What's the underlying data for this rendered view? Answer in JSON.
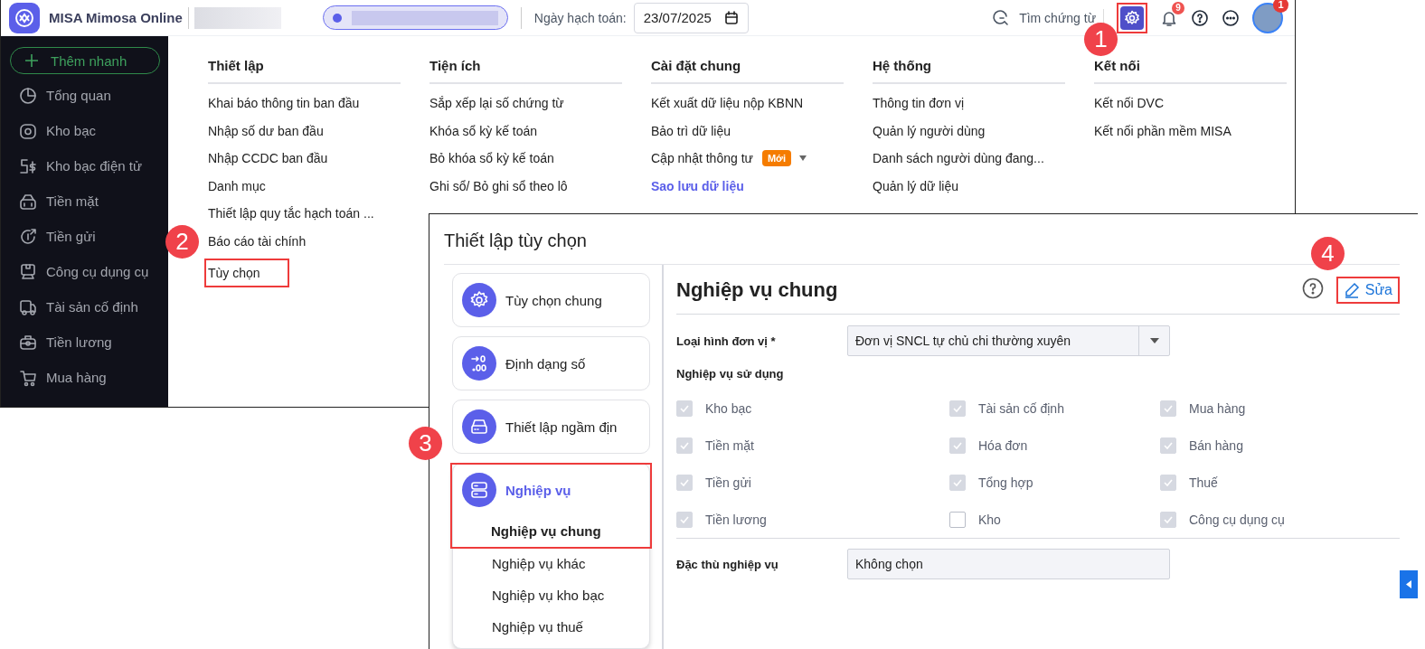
{
  "app": {
    "name": "MISA Mimosa Online",
    "date_label": "Ngày hạch toán:",
    "date_value": "23/07/2025",
    "search_label": "Tìm chứng từ",
    "settings_highlighted": true,
    "notification_count": "9",
    "avatar_badge": "1"
  },
  "sidebar": {
    "quick_add": "Thêm nhanh",
    "items": [
      {
        "label": "Tổng quan"
      },
      {
        "label": "Kho bạc"
      },
      {
        "label": "Kho bạc điện tử"
      },
      {
        "label": "Tiền mặt"
      },
      {
        "label": "Tiền gửi"
      },
      {
        "label": "Công cụ dụng cụ"
      },
      {
        "label": "Tài sản cố định"
      },
      {
        "label": "Tiền lương"
      },
      {
        "label": "Mua hàng"
      }
    ]
  },
  "menu_columns": [
    {
      "heading": "Thiết lập",
      "items": [
        {
          "kind": "plain",
          "label": "Khai báo thông tin ban đầu",
          "highlighted": false
        },
        {
          "kind": "plain",
          "label": "Nhập số dư ban đầu",
          "highlighted": false
        },
        {
          "kind": "plain",
          "label": "Nhập CCDC ban đầu",
          "highlighted": false
        },
        {
          "kind": "plain",
          "label": "Danh mục",
          "highlighted": false
        },
        {
          "kind": "plain",
          "label": "Thiết lập quy tắc hạch toán ...",
          "highlighted": false
        },
        {
          "kind": "plain",
          "label": "Báo cáo tài chính",
          "highlighted": false
        },
        {
          "kind": "plain",
          "label": "Tùy chọn",
          "highlighted": true
        }
      ]
    },
    {
      "heading": "Tiện ích",
      "items": [
        {
          "kind": "plain",
          "label": "Sắp xếp lại số chứng từ",
          "highlighted": false
        },
        {
          "kind": "plain",
          "label": "Khóa sổ kỳ kế toán",
          "highlighted": false
        },
        {
          "kind": "plain",
          "label": "Bỏ khóa sổ kỳ kế toán",
          "highlighted": false
        },
        {
          "kind": "plain",
          "label": "Ghi sổ/ Bỏ ghi sổ theo lô",
          "highlighted": false
        }
      ]
    },
    {
      "heading": "Cài đặt chung",
      "items": [
        {
          "kind": "plain",
          "label": "Kết xuất dữ liệu nộp KBNN",
          "highlighted": false
        },
        {
          "kind": "plain",
          "label": "Bảo trì dữ liệu",
          "highlighted": false
        },
        {
          "kind": "badge",
          "label": "Cập nhật thông tư",
          "badge": "Mới",
          "highlighted": false
        },
        {
          "kind": "accent",
          "label": "Sao lưu dữ liệu",
          "highlighted": false
        }
      ]
    },
    {
      "heading": "Hệ thống",
      "items": [
        {
          "kind": "plain",
          "label": "Thông tin đơn vị",
          "highlighted": false
        },
        {
          "kind": "plain",
          "label": "Quản lý người dùng",
          "highlighted": false
        },
        {
          "kind": "plain",
          "label": "Danh sách người dùng đang...",
          "highlighted": false
        },
        {
          "kind": "plain",
          "label": "Quản lý dữ liệu",
          "highlighted": false
        }
      ]
    },
    {
      "heading": "Kết nối",
      "items": [
        {
          "kind": "plain",
          "label": "Kết nối DVC",
          "highlighted": false
        },
        {
          "kind": "plain",
          "label": "Kết nối phần mềm MISA",
          "highlighted": false
        }
      ]
    }
  ],
  "dialog": {
    "title": "Thiết lập tùy chọn",
    "nav": [
      {
        "label": "Tùy chọn chung",
        "selected": false,
        "highlighted": false
      },
      {
        "label": "Định dạng số",
        "selected": false,
        "highlighted": false
      },
      {
        "label": "Thiết lập ngầm địn",
        "selected": false,
        "highlighted": false
      },
      {
        "label": "Nghiệp vụ",
        "selected": true,
        "highlighted": true,
        "children": [
          {
            "label": "Nghiệp vụ chung",
            "selected": true
          },
          {
            "label": "Nghiệp vụ khác",
            "selected": false
          },
          {
            "label": "Nghiệp vụ kho bạc",
            "selected": false
          },
          {
            "label": "Nghiệp vụ thuế",
            "selected": false
          }
        ]
      }
    ],
    "panel": {
      "title": "Nghiệp vụ chung",
      "edit_label": "Sửa",
      "edit_highlighted": true,
      "unit_type_label": "Loại hình đơn vị *",
      "unit_type_value": "Đơn vị SNCL tự chủ chi thường xuyên",
      "usage_label": "Nghiệp vụ sử dụng",
      "usage_disabled": true,
      "usage": [
        {
          "label": "Kho bạc",
          "checked": true
        },
        {
          "label": "Tài sản cố định",
          "checked": true
        },
        {
          "label": "Mua hàng",
          "checked": true
        },
        {
          "label": "Tiền mặt",
          "checked": true
        },
        {
          "label": "Hóa đơn",
          "checked": true
        },
        {
          "label": "Bán hàng",
          "checked": true
        },
        {
          "label": "Tiền gửi",
          "checked": true
        },
        {
          "label": "Tổng hợp",
          "checked": true
        },
        {
          "label": "Thuế",
          "checked": true
        },
        {
          "label": "Tiền lương",
          "checked": true
        },
        {
          "label": "Kho",
          "checked": false
        },
        {
          "label": "Công cụ dụng cụ",
          "checked": true
        }
      ],
      "special_label": "Đặc thù nghiệp vụ",
      "special_value": "Không chọn"
    }
  },
  "callouts": [
    {
      "number": "1"
    },
    {
      "number": "2"
    },
    {
      "number": "3"
    },
    {
      "number": "4"
    }
  ]
}
